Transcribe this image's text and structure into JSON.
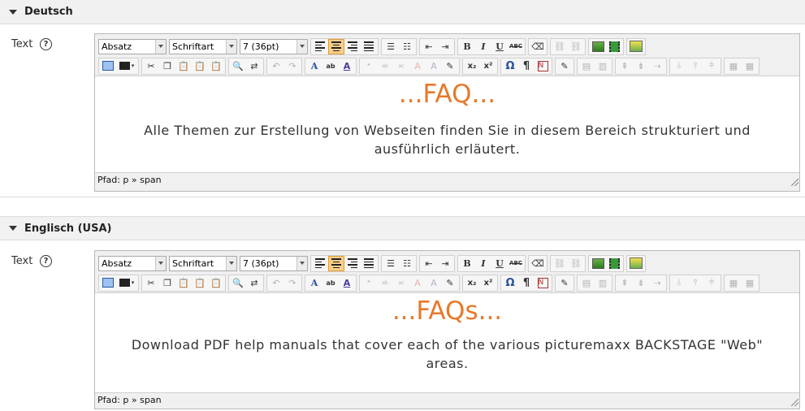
{
  "sections": [
    {
      "title": "Deutsch",
      "field_label": "Text",
      "help": "?",
      "toolbar": {
        "format": "Absatz",
        "font": "Schriftart",
        "size": "7 (36pt)"
      },
      "heading": "...FAQ...",
      "paragraph": "Alle Themen zur Erstellung von Webseiten finden Sie in diesem Bereich strukturiert und ausführlich erläutert.",
      "path_label": "Pfad: p » span"
    },
    {
      "title": "Englisch (USA)",
      "field_label": "Text",
      "help": "?",
      "toolbar": {
        "format": "Absatz",
        "font": "Schriftart",
        "size": "7 (36pt)"
      },
      "heading": "...FAQs...",
      "paragraph": "Download PDF help manuals that cover each of the various picturemaxx BACKSTAGE \"Web\" areas.",
      "path_label": "Pfad: p » span"
    }
  ],
  "toolbar_buttons": {
    "bold": "B",
    "italic": "I",
    "underline": "U",
    "strike": "ABC",
    "subscript": "x₂",
    "superscript": "x²",
    "omega": "Ω",
    "pilcrow": "¶",
    "font_color": "A",
    "highlight": "ab",
    "styles": "A"
  },
  "colors": {
    "accent": "#e8782a",
    "active_button": "#f8cf8a",
    "header_bg": "#f1f1f1"
  }
}
